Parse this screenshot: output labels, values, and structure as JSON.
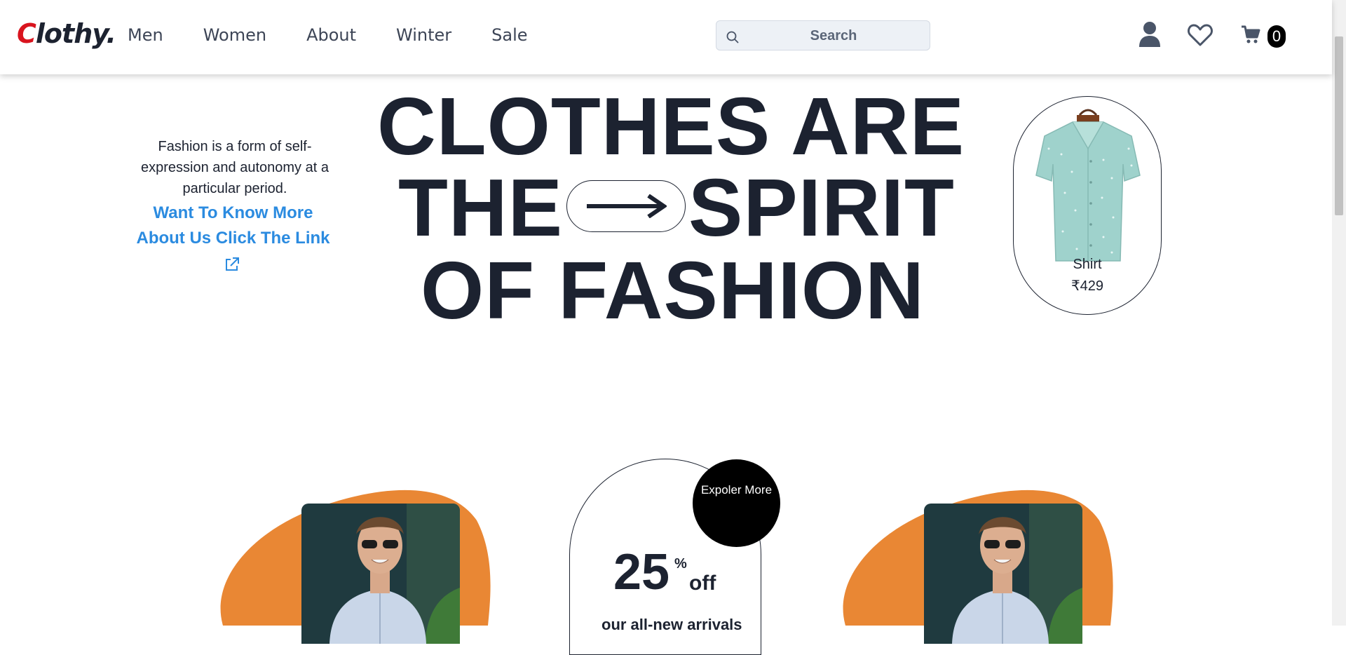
{
  "header": {
    "logo_first": "C",
    "logo_rest": "lothy.",
    "nav": [
      "Men",
      "Women",
      "About",
      "Winter",
      "Sale"
    ],
    "search_placeholder": "Search",
    "cart_count": "0",
    "icons": [
      "search-icon",
      "user-icon",
      "heart-icon",
      "cart-icon"
    ]
  },
  "hero": {
    "intro": "Fashion is a form of self-expression and autonomy at a particular period.",
    "link_line1": "Want To Know More",
    "link_line2": "About Us Click The Link",
    "heading_line1": "CLOTHES ARE",
    "heading_line2a": "THE",
    "heading_line2b": "SPIRIT",
    "heading_line3": "OF FASHION"
  },
  "product": {
    "name": "Shirt",
    "price": "₹429"
  },
  "promo": {
    "explore": "Expoler More",
    "discount": "25",
    "percent": "%",
    "off": "off",
    "subtitle": "our all-new arrivals"
  },
  "colors": {
    "brand_red": "#d9141e",
    "link_blue": "#2b8be0",
    "blob_orange": "#e98734",
    "text_dark": "#1c2230"
  }
}
